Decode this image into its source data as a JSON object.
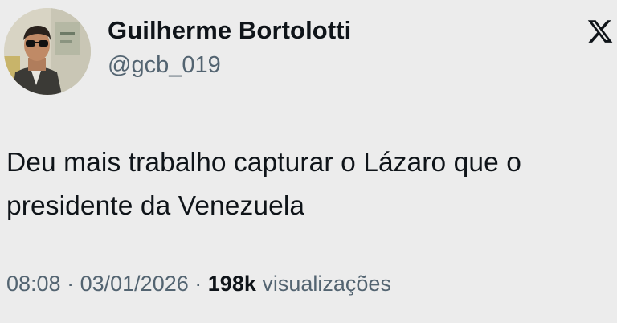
{
  "author": {
    "display_name": "Guilherme Bortolotti",
    "handle": "@gcb_019",
    "avatar_icon": "profile-photo"
  },
  "platform_icon": "x-logo-icon",
  "tweet": {
    "text_line_1": "Deu mais trabalho capturar o Lázaro que o",
    "text_line_2": "presidente da Venezuela"
  },
  "meta": {
    "time": "08:08",
    "separator": "·",
    "date": "03/01/2026",
    "views_count": "198k",
    "views_label": "visualizações"
  },
  "colors": {
    "background": "#ececec",
    "primary_text": "#0f1419",
    "secondary_text": "#536471"
  }
}
